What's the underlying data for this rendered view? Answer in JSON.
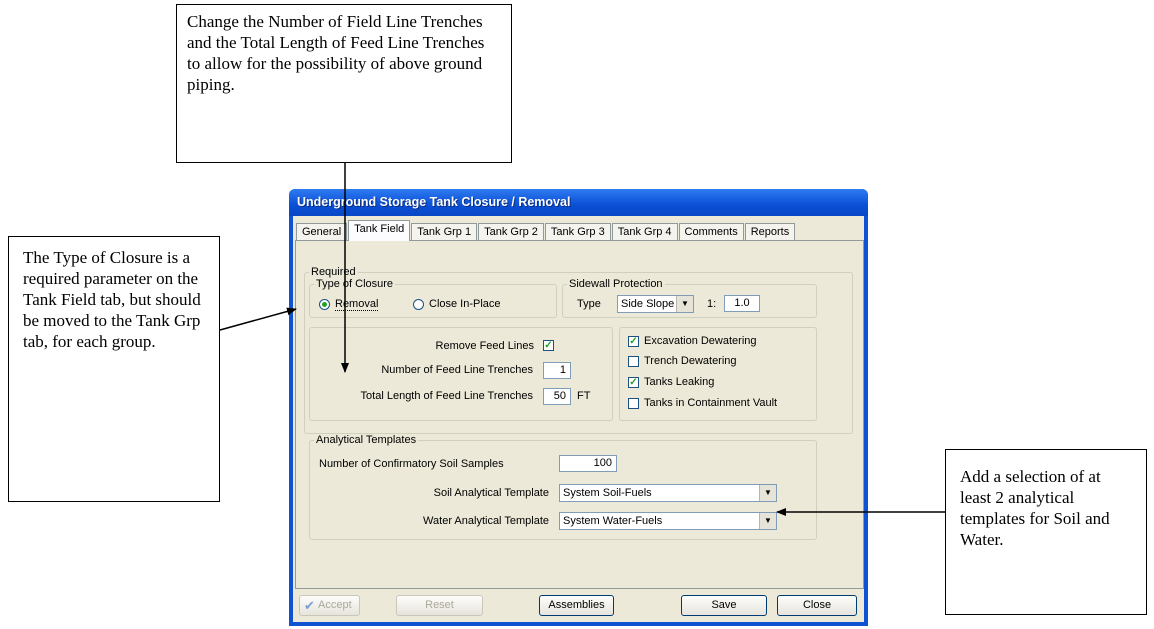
{
  "callouts": {
    "top": "Change the Number of Field Line Trenches and the Total Length of Feed Line Trenches to allow for the possibility of above ground piping.",
    "left": "The Type of Closure is a required parameter on the Tank Field tab, but should be moved to the Tank Grp tab, for each group.",
    "right": "Add a selection of at least 2 analytical templates for Soil and Water."
  },
  "window": {
    "title": "Underground Storage Tank Closure / Removal",
    "tabs": [
      "General",
      "Tank Field",
      "Tank Grp 1",
      "Tank Grp 2",
      "Tank Grp 3",
      "Tank Grp 4",
      "Comments",
      "Reports"
    ],
    "active_tab": "Tank Field"
  },
  "required": {
    "legend": "Required",
    "type_of_closure": {
      "legend": "Type of Closure",
      "options": [
        "Removal",
        "Close In-Place"
      ],
      "selected": "Removal"
    },
    "sidewall": {
      "legend": "Sidewall Protection",
      "type_label": "Type",
      "type_value": "Side Slope",
      "ratio_label": "1:",
      "ratio_value": "1.0"
    },
    "feed": {
      "remove_label": "Remove Feed Lines",
      "remove_checked": true,
      "trenches_label": "Number of Feed Line Trenches",
      "trenches_value": "1",
      "length_label": "Total Length of Feed Line Trenches",
      "length_value": "50",
      "length_unit": "FT"
    },
    "options": [
      {
        "label": "Excavation Dewatering",
        "checked": true
      },
      {
        "label": "Trench Dewatering",
        "checked": false
      },
      {
        "label": "Tanks Leaking",
        "checked": true
      },
      {
        "label": "Tanks in Containment Vault",
        "checked": false
      }
    ]
  },
  "analytical": {
    "legend": "Analytical Templates",
    "samples_label": "Number of Confirmatory Soil Samples",
    "samples_value": "100",
    "soil_label": "Soil Analytical Template",
    "soil_value": "System Soil-Fuels",
    "water_label": "Water Analytical Template",
    "water_value": "System Water-Fuels"
  },
  "buttons": {
    "accept": "Accept",
    "reset": "Reset",
    "assemblies": "Assemblies",
    "save": "Save",
    "close": "Close"
  },
  "colors": {
    "title_bar": "#0a4fd6",
    "dialog_bg": "#ece9d8",
    "check_mark": "#21a121"
  }
}
